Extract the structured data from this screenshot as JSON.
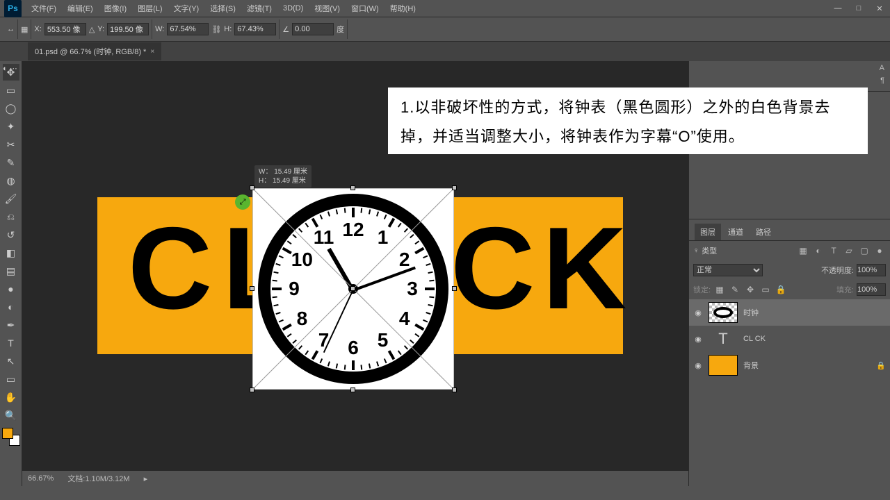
{
  "menu": {
    "file": "文件(F)",
    "edit": "编辑(E)",
    "image": "图像(I)",
    "layer": "图层(L)",
    "type": "文字(Y)",
    "select": "选择(S)",
    "filter": "滤镜(T)",
    "d3": "3D(D)",
    "view": "视图(V)",
    "window": "窗口(W)",
    "help": "帮助(H)"
  },
  "win": {
    "min": "—",
    "max": "□",
    "close": "✕"
  },
  "opt": {
    "x_lbl": "X:",
    "x": "553.50 像",
    "y_lbl": "Y:",
    "y": "199.50 像",
    "w_lbl": "W:",
    "w": "67.54%",
    "h_lbl": "H:",
    "h": "67.43%",
    "rot": "0.00",
    "rot_unit": "度",
    "link": "⛓",
    "interp": "⟳"
  },
  "tab": {
    "title": "01.psd @ 66.7% (时钟, RGB/8) *",
    "close": "×"
  },
  "tools": {
    "move": "✥",
    "marquee": "▭",
    "lasso": "◯",
    "wand": "✦",
    "crop": "✂",
    "eyedrop": "✎",
    "heal": "◍",
    "brush": "🖌",
    "stamp": "⎌",
    "history": "↺",
    "eraser": "◧",
    "grad": "▤",
    "blur": "●",
    "dodge": "◐",
    "pen": "✒",
    "type": "T",
    "path": "↖",
    "shape": "▭",
    "hand": "✋",
    "zoom": "🔍"
  },
  "dims": {
    "w": "W： 15.49 厘米",
    "h": "H： 15.49 厘米"
  },
  "letters": {
    "c1": "C",
    "l": "L",
    "c2": "C",
    "k": "K"
  },
  "clock": {
    "numbers": [
      "12",
      "1",
      "2",
      "3",
      "4",
      "5",
      "6",
      "7",
      "8",
      "9",
      "10",
      "11"
    ]
  },
  "instruction": "1.以非破坏性的方式，将钟表（黑色圆形）之外的白色背景去掉，并适当调整大小，将钟表作为字幕“O”使用。",
  "panels": {
    "layers": "图层",
    "channels": "通道",
    "paths": "路径",
    "kind": "类型",
    "blend": "正常",
    "opacity_lbl": "不透明度:",
    "opacity": "100%",
    "fill_lbl": "填充:",
    "fill": "100%",
    "lock_lbl": "锁定:"
  },
  "layer_search": "♀",
  "layers": [
    {
      "eye": "◉",
      "name": "时钟"
    },
    {
      "eye": "◉",
      "name": "CL  CK",
      "thumb": "T"
    },
    {
      "eye": "◉",
      "name": "背景",
      "lock": "🔒"
    }
  ],
  "status": {
    "zoom": "66.67%",
    "doc": "文档:1.10M/3.12M",
    "arrow": "▸"
  },
  "right_top": {
    "a": "A",
    "pilcrow": "¶"
  }
}
